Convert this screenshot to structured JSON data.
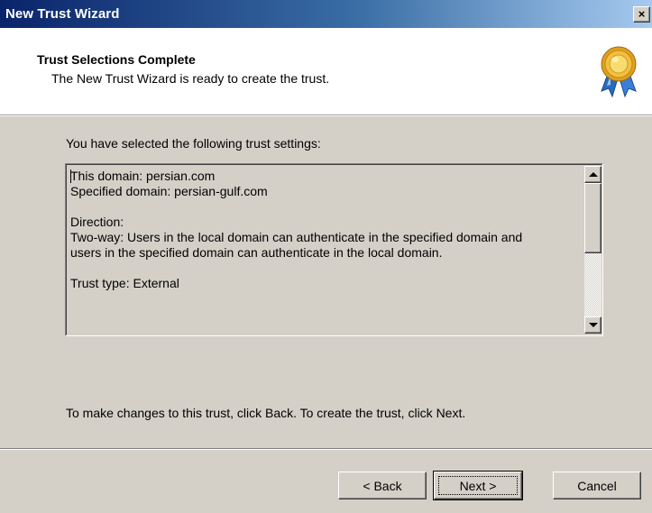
{
  "window": {
    "title": "New Trust Wizard",
    "close_label": "×"
  },
  "header": {
    "title": "Trust Selections Complete",
    "subtitle": "The New Trust Wizard is ready to create the trust.",
    "icon": "award-medal-icon"
  },
  "main": {
    "intro": "You have selected the following trust settings:",
    "settings_text": "This domain: persian.com\nSpecified domain: persian-gulf.com\n\nDirection:\nTwo-way: Users in the local domain can authenticate in the specified domain and\nusers in the specified domain can authenticate in the local domain.\n\nTrust type: External",
    "instruction": "To make changes to this trust, click Back. To create the trust, click Next."
  },
  "buttons": {
    "back": "< Back",
    "next": "Next >",
    "cancel": "Cancel"
  },
  "colors": {
    "titlebar_start": "#0a246a",
    "titlebar_end": "#a6caf0",
    "dialog_bg": "#d4d0c8",
    "header_bg": "#ffffff"
  }
}
